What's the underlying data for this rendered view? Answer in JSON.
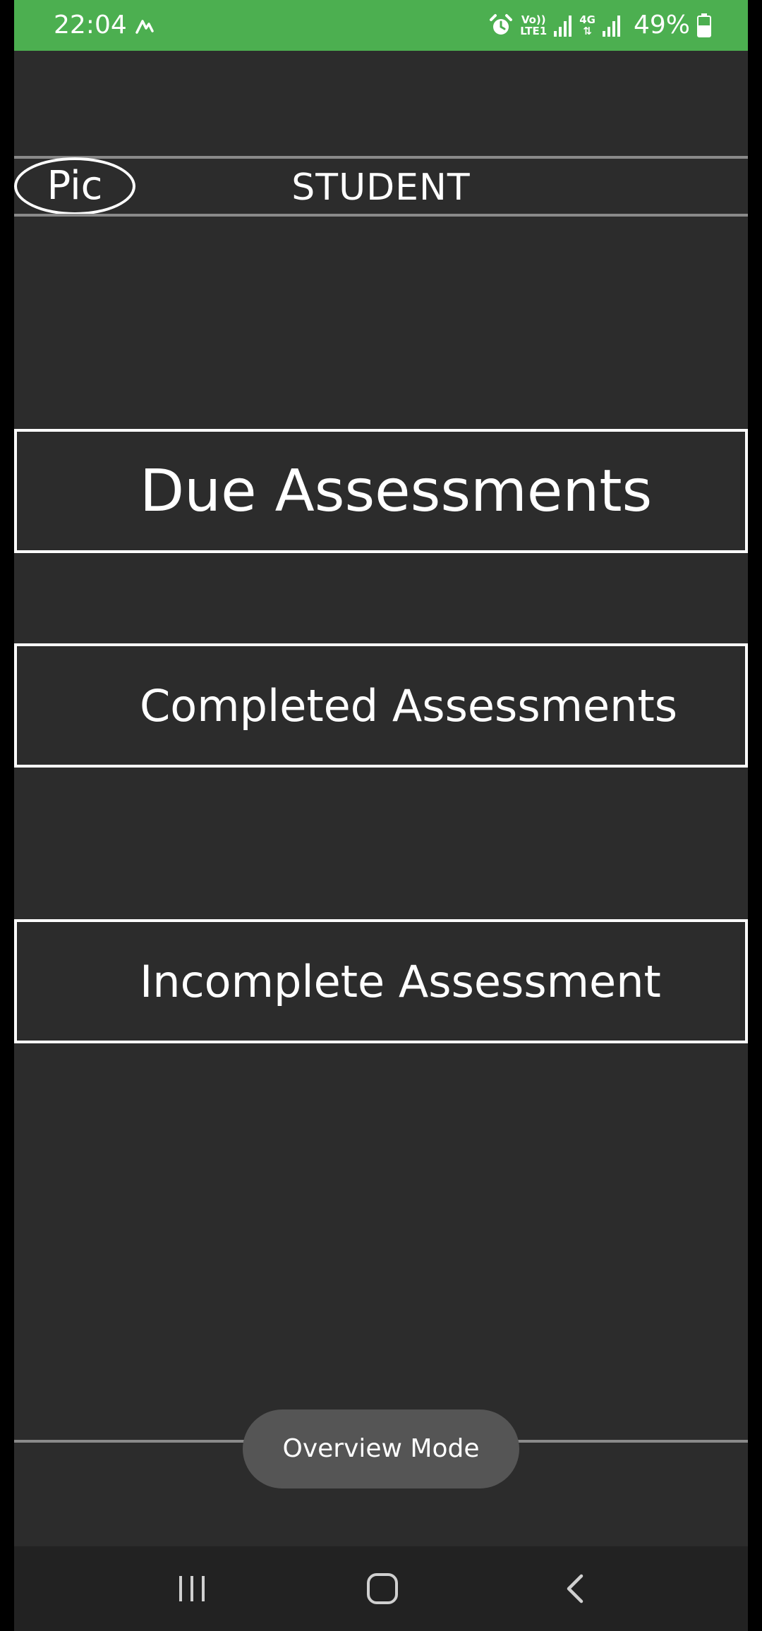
{
  "status_bar": {
    "time": "22:04",
    "net1_top": "Vo))",
    "net1_bottom": "LTE1",
    "net2_top": "4G",
    "battery_percent": "49%",
    "icons": [
      "alarm-icon",
      "signal-icon",
      "signal-icon",
      "battery-icon"
    ]
  },
  "header": {
    "avatar_label": "Pic",
    "title": "STUDENT"
  },
  "menu": {
    "due_label": "Due Assessments",
    "completed_label": "Completed Assessments",
    "incomplete_label": "Incomplete Assessment"
  },
  "toast": {
    "text": "Overview Mode"
  },
  "nav_bar": {
    "icons": [
      "recents-icon",
      "home-icon",
      "back-icon"
    ]
  },
  "colors": {
    "status_bar": "#4caf50",
    "background": "#2c2c2c",
    "toast": "#555555",
    "divider": "#8a8a8a"
  }
}
